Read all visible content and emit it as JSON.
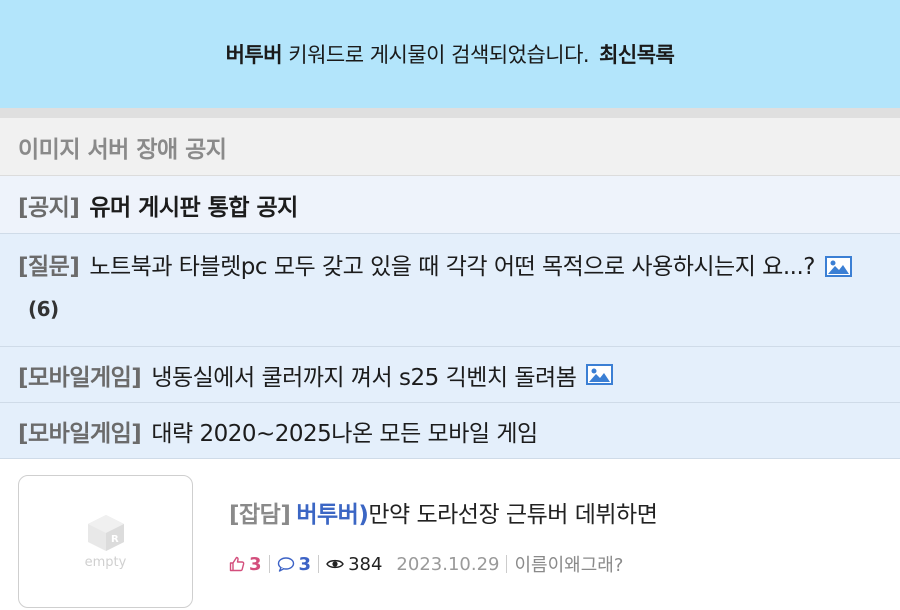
{
  "banner": {
    "keyword": "버투버",
    "message": "키워드로 게시물이 검색되었습니다.",
    "link": "최신목록"
  },
  "notice_gray": "이미지 서버 장애 공지",
  "rows": [
    {
      "category": "[공지]",
      "title": "유머 게시판 통합 공지"
    },
    {
      "category": "[질문]",
      "title": "노트북과 타블렛pc 모두 갖고 있을 때 각각 어떤 목적으로 사용하시는지 요...?",
      "count": "(6)"
    },
    {
      "category": "[모바일게임]",
      "title": "냉동실에서 쿨러까지 껴서 s25 긱벤치 돌려봄"
    },
    {
      "category": "[모바일게임]",
      "title": "대략 2020~2025나온 모든 모바일 게임"
    }
  ],
  "post": {
    "thumb_label": "empty",
    "tag": "[잡담]",
    "keyword": "버투버)",
    "title": "만약 도라선장 근튜버 데뷔하면",
    "likes": "3",
    "comments": "3",
    "views": "384",
    "date": "2023.10.29",
    "author": "이름이왜그래?"
  }
}
